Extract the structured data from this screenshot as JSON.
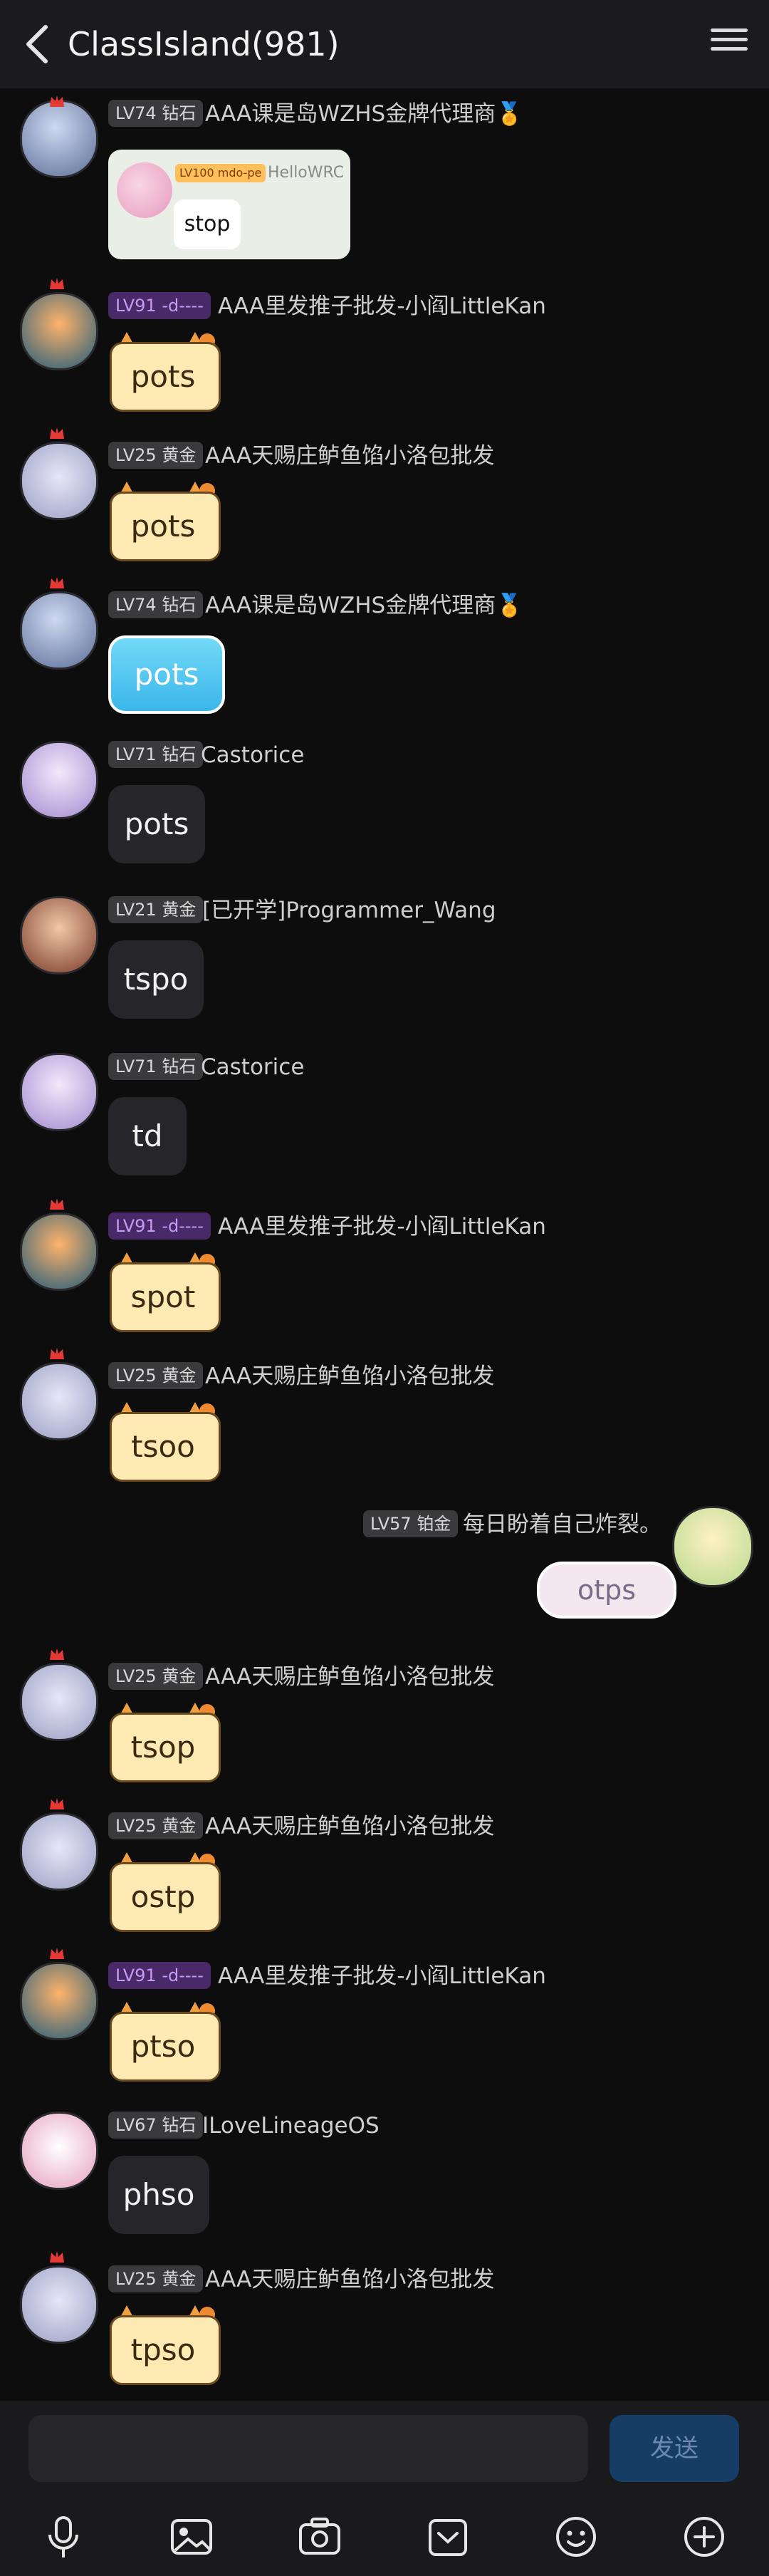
{
  "header": {
    "title": "ClassIsland(981)"
  },
  "messages": [
    {
      "level": "LV74 钻石",
      "name": "AAA课是岛WZHS金牌代理商🏅",
      "quote": {
        "level": "LV100 mdo-pe",
        "name": "HelloWRC",
        "text": "stop"
      }
    },
    {
      "level": "LV91 -d----",
      "name": "AAA里发推子批发-小阎LittleKan",
      "text": "pots"
    },
    {
      "level": "LV25 黄金",
      "name": "AAA天赐庄鲈鱼馅小洛包批发",
      "text": "pots"
    },
    {
      "level": "LV74 钻石",
      "name": "AAA课是岛WZHS金牌代理商🏅",
      "text": "pots"
    },
    {
      "level": "LV71 钻石",
      "name": "Castorice",
      "text": "pots"
    },
    {
      "level": "LV21 黄金",
      "name": "[已开学]Programmer_Wang",
      "text": "tspo"
    },
    {
      "level": "LV71 钻石",
      "name": "Castorice",
      "text": "td"
    },
    {
      "level": "LV91 -d----",
      "name": "AAA里发推子批发-小阎LittleKan",
      "text": "spot"
    },
    {
      "level": "LV25 黄金",
      "name": "AAA天赐庄鲈鱼馅小洛包批发",
      "text": "tsoo"
    },
    {
      "level": "LV57 铂金",
      "name": "每日盼着自己炸裂。",
      "text": "otps"
    },
    {
      "level": "LV25 黄金",
      "name": "AAA天赐庄鲈鱼馅小洛包批发",
      "text": "tsop"
    },
    {
      "level": "LV25 黄金",
      "name": "AAA天赐庄鲈鱼馅小洛包批发",
      "text": "ostp"
    },
    {
      "level": "LV91 -d----",
      "name": "AAA里发推子批发-小阎LittleKan",
      "text": "ptso"
    },
    {
      "level": "LV67 钻石",
      "name": "ILoveLineageOS",
      "text": "phso"
    },
    {
      "level": "LV25 黄金",
      "name": "AAA天赐庄鲈鱼馅小洛包批发",
      "text": "tpso"
    }
  ],
  "composer": {
    "placeholder": "",
    "send_label": "发送"
  },
  "toolbar": {
    "icons": [
      "mic-icon",
      "image-icon",
      "camera-icon",
      "wallet-icon",
      "emoji-icon",
      "plus-icon"
    ]
  },
  "colors": {
    "background": "#0d0d0e",
    "send_button": "#163d66",
    "purple_badge": "#4a2968"
  }
}
